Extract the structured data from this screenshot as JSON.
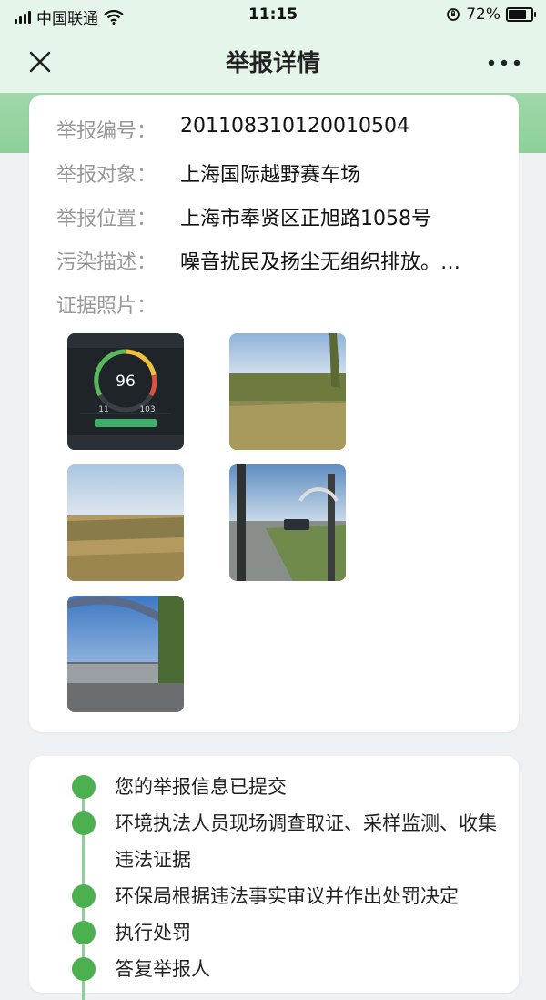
{
  "status_bar": {
    "carrier": "中国联通",
    "time": "11:15",
    "battery_percent": "72%",
    "battery_level": 0.72
  },
  "header": {
    "title": "举报详情",
    "close_icon": "close-icon",
    "more_icon": "more-dots-icon"
  },
  "report": {
    "fields": [
      {
        "label": "举报编号：",
        "value": "201108310120010504"
      },
      {
        "label": "举报对象：",
        "value": "上海国际越野赛车场"
      },
      {
        "label": "举报位置：",
        "value": "上海市奉贤区正旭路1058号"
      },
      {
        "label": "污染描述：",
        "value": "噪音扰民及扬尘无组织排放。…"
      }
    ],
    "photos_label": "证据照片：",
    "photos": [
      {
        "type": "noise-meter-screenshot",
        "reading": "96",
        "sub_left": "11",
        "sub_right": "103"
      },
      {
        "type": "field-photo"
      },
      {
        "type": "field-photo"
      },
      {
        "type": "gate-photo"
      },
      {
        "type": "entrance-arch-photo"
      }
    ]
  },
  "progress": {
    "steps": [
      {
        "text": "您的举报信息已提交"
      },
      {
        "text": "环境执法人员现场调查取证、采样监测、收集违法证据"
      },
      {
        "text": "环保局根据违法事实审议并作出处罚决定"
      },
      {
        "text": "执行处罚"
      },
      {
        "text": "答复举报人"
      }
    ]
  },
  "colors": {
    "accent_green": "#4caf50",
    "header_bg": "#e6f5e9",
    "label_gray": "#999999"
  }
}
